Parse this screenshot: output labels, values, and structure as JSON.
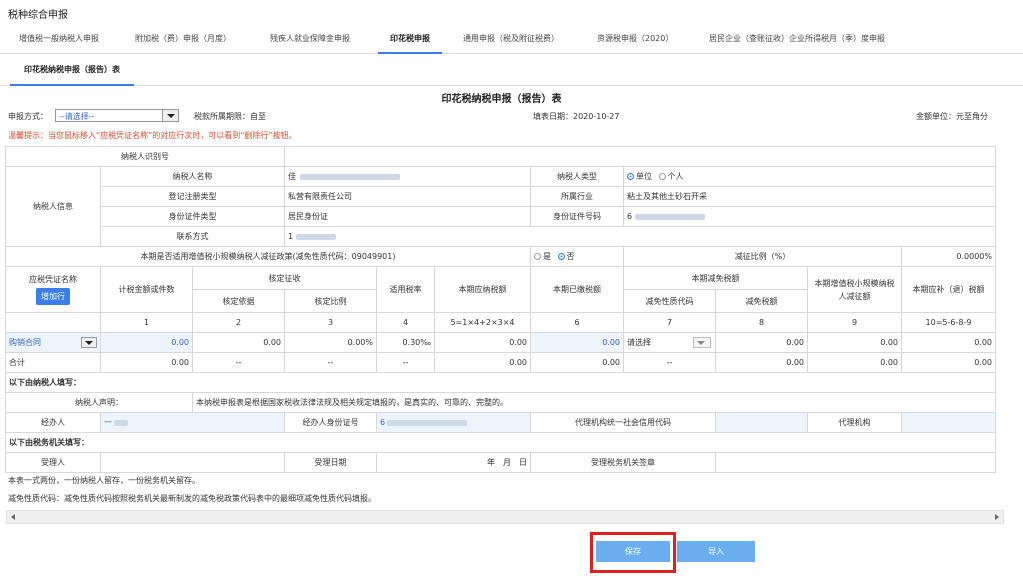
{
  "app": {
    "title": "税种综合申报"
  },
  "tabs": [
    {
      "label": "增值税一般纳税人申报",
      "active": false
    },
    {
      "label": "附加税（费）申报（月度）",
      "active": false
    },
    {
      "label": "残疾人就业保障金申报",
      "active": false
    },
    {
      "label": "印花税申报",
      "active": true
    },
    {
      "label": "通用申报（税及附征税费）",
      "active": false
    },
    {
      "label": "资源税申报（2020）",
      "active": false
    },
    {
      "label": "居民企业（查账征收）企业所得税月（季）度申报",
      "active": false
    }
  ],
  "subtab": {
    "label": "印花税纳税申报（报告）表"
  },
  "form": {
    "title": "印花税纳税申报（报告）表",
    "method_label": "申报方式：",
    "method_placeholder": "--请选择--",
    "period_label": "税款所属期限：自至",
    "fill_date": "填表日期：2020-10-27",
    "unit": "金额单位：元至角分",
    "warning": "温馨提示：当您鼠标移入“应税凭证名称”的对应行次时，可以看到“删除行”按钮。"
  },
  "taxpayer": {
    "id_label": "纳税人识别号",
    "info_label": "纳税人信息",
    "name_label": "纳税人名称",
    "name_value": "佳",
    "type_label": "纳税人类型",
    "type_options": [
      "单位",
      "个人"
    ],
    "type_selected": "单位",
    "reg_type_label": "登记注册类型",
    "reg_type_value": "私营有限责任公司",
    "industry_label": "所属行业",
    "industry_value": "粘土及其他土砂石开采",
    "id_type_label": "身份证件类型",
    "id_type_value": "居民身份证",
    "id_no_label": "身份证件号码",
    "id_no_value": "6",
    "contact_label": "联系方式",
    "contact_value": "1"
  },
  "policy": {
    "question": "本期是否适用增值税小规模纳税人减征政策(减免性质代码：09049901)",
    "options": [
      "是",
      "否"
    ],
    "selected": "否",
    "ratio_label": "减征比例（%）",
    "ratio_value": "0.0000%"
  },
  "columns": {
    "doc_name": "应税凭证名称",
    "add_row": "增加行",
    "amount": "计税金额或件数",
    "assessed": "核定征收",
    "basis": "核定依据",
    "ratio": "核定比例",
    "rate": "适用税率",
    "payable": "本期应纳税额",
    "paid": "本期已缴税额",
    "reduction": "本期减免税额",
    "reduction_code": "减免性质代码",
    "reduction_amount": "减免税额",
    "small_scale": "本期增值税小规模纳税人减征额",
    "refund": "本期应补（退）税额",
    "indices": [
      "1",
      "2",
      "3",
      "4",
      "5=1×4+2×3×4",
      "6",
      "7",
      "8",
      "9",
      "10=5-6-8-9"
    ]
  },
  "row": {
    "doc": "购销合同",
    "amount": "0.00",
    "basis": "0.00",
    "ratio": "0.00%",
    "rate": "0.30‰",
    "payable": "0.00",
    "paid": "0.00",
    "code": "请选择",
    "reduction": "0.00",
    "small": "0.00",
    "refund": "0.00"
  },
  "total": {
    "label": "合计",
    "amount": "0.00",
    "basis": "--",
    "ratio": "--",
    "rate": "--",
    "payable": "0.00",
    "paid": "0.00",
    "code": "--",
    "reduction": "0.00",
    "small": "0.00",
    "refund": "0.00"
  },
  "taxpayer_section": {
    "heading": "以下由纳税人填写：",
    "declaration_label": "纳税人声明：",
    "declaration": "本纳税申报表是根据国家税收法律法规及相关规定填报的，是真实的、可靠的、完整的。",
    "agent_label": "经办人",
    "agent_value": "一",
    "agent_id_label": "经办人身份证号",
    "agent_id_value": "6",
    "agency_code_label": "代理机构统一社会信用代码",
    "agency_label": "代理机构"
  },
  "tax_office": {
    "heading": "以下由税务机关填写：",
    "receiver_label": "受理人",
    "date_label": "受理日期",
    "date_value": "年　月　日",
    "office_stamp_label": "受理税务机关签章"
  },
  "notes": [
    "本表一式两份，一份纳税人留存，一份税务机关留存。",
    "减免性质代码：减免性质代码按照税务机关最新制发的减免税政策代码表中的最细项减免性质代码填报。"
  ],
  "buttons": {
    "save": "保存",
    "import": "导入"
  },
  "colors": {
    "accent": "#3a7ee8",
    "button": "#6aaef0",
    "warning": "#e24a2a",
    "highlight": "#e02020"
  }
}
